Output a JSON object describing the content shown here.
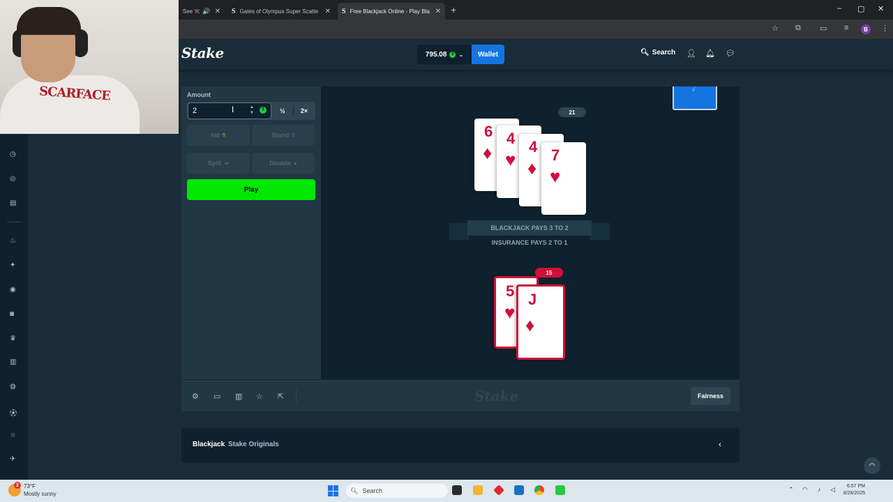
{
  "browser": {
    "tabs": [
      {
        "title": "See You'",
        "favicon": "",
        "has_audio": true
      },
      {
        "title": "Gates of Olympus Super Scatte",
        "favicon": "S"
      },
      {
        "title": "Free Blackjack Online - Play Bla",
        "favicon": "S",
        "active": true
      }
    ],
    "new_tab_label": "+",
    "window_controls": [
      "–",
      "▢",
      "✕"
    ],
    "profile_initial": "B"
  },
  "header": {
    "logo": "Stake",
    "balance": "795.08",
    "currency_symbol": "$",
    "wallet_label": "Wallet",
    "search_label": "Search"
  },
  "webcam": {
    "shirt_text": "SCARFACE"
  },
  "controls": {
    "amount_label": "Amount",
    "amount_value": "2",
    "half_label": "½",
    "double_label": "2×",
    "hit_label": "Hit",
    "stand_label": "Stand",
    "split_label": "Split",
    "double_down_label": "Double",
    "play_label": "Play"
  },
  "table": {
    "dealer_score": "21",
    "dealer_cards": [
      {
        "rank": "6",
        "suit": "♦"
      },
      {
        "rank": "4",
        "suit": "♥"
      },
      {
        "rank": "4",
        "suit": "♦"
      },
      {
        "rank": "7",
        "suit": "♥"
      }
    ],
    "banner_text": "BLACKJACK PAYS 3 TO 2",
    "insurance_text": "INSURANCE PAYS 2 TO 1",
    "player_score": "15",
    "player_cards": [
      {
        "rank": "5",
        "suit": "♥"
      },
      {
        "rank": "J",
        "suit": "♦"
      }
    ]
  },
  "footer": {
    "logo": "Stake",
    "fairness_label": "Fairness"
  },
  "info_bar": {
    "title": "Blackjack",
    "subtitle": "Stake Originals"
  },
  "taskbar": {
    "weather_badge": "2",
    "temperature": "73°F",
    "weather_desc": "Mostly sunny",
    "search_label": "Search",
    "time": "6:57 PM",
    "date": "8/26/2025"
  },
  "colors": {
    "accent_green": "#00e701",
    "wallet_blue": "#1475e1",
    "card_red": "#d0103a",
    "bg": "#1a2c38"
  }
}
